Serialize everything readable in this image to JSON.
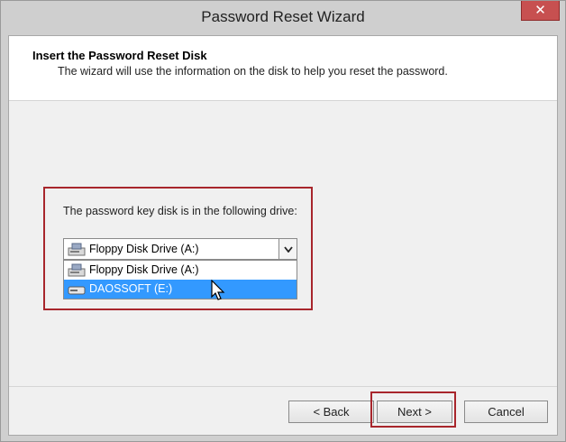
{
  "window": {
    "title": "Password Reset Wizard",
    "close_glyph": "✕"
  },
  "header": {
    "title": "Insert the Password Reset Disk",
    "subtitle": "The wizard will use the information on the disk to help you reset the password."
  },
  "drive": {
    "label": "The password key disk is in the following drive:",
    "selected": "Floppy Disk Drive (A:)",
    "options": [
      {
        "label": "Floppy Disk Drive (A:)",
        "icon": "floppy-drive-icon",
        "highlighted": false
      },
      {
        "label": "DAOSSOFT (E:)",
        "icon": "removable-drive-icon",
        "highlighted": true
      }
    ]
  },
  "buttons": {
    "back": "< Back",
    "next": "Next >",
    "cancel": "Cancel"
  },
  "colors": {
    "annotation_red": "#a8262c",
    "selection_blue": "#3399ff",
    "close_red": "#c75050"
  }
}
